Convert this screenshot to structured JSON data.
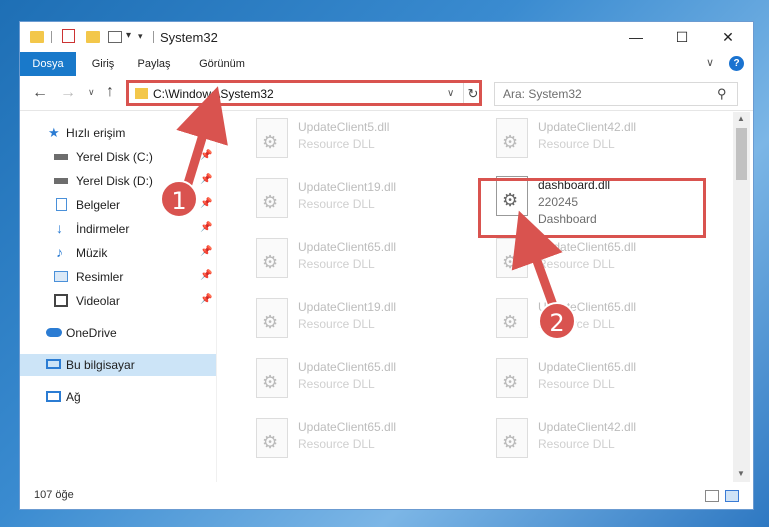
{
  "window": {
    "title": "System32",
    "qat_dropdown_glyph": "▾",
    "min_glyph": "—",
    "max_glyph": "☐",
    "close_glyph": "✕"
  },
  "ribbon": {
    "tabs": [
      "Dosya",
      "Giriş",
      "Paylaş",
      "Görünüm"
    ],
    "expand_glyph": "∨",
    "help_glyph": "?"
  },
  "nav": {
    "back_glyph": "←",
    "forward_glyph": "→",
    "recent_glyph": "∨",
    "up_glyph": "↑",
    "address": "C:\\Windows\\System32",
    "address_drop_glyph": "∨",
    "refresh_glyph": "↻",
    "search_placeholder": "Ara: System32",
    "search_glyph": "⚲"
  },
  "sidebar": {
    "pin_glyph": "📌",
    "items": [
      {
        "label": "Hızlı erişim",
        "icon": "star-icon",
        "color": "#2b7cd3",
        "pinned": false
      },
      {
        "label": "Yerel Disk (C:)",
        "icon": "drive-icon",
        "color": "#6d6d6d",
        "pinned": true
      },
      {
        "label": "Yerel Disk (D:)",
        "icon": "drive-icon",
        "color": "#6d6d6d",
        "pinned": true
      },
      {
        "label": "Belgeler",
        "icon": "documents-icon",
        "color": "#4a90d9",
        "pinned": true
      },
      {
        "label": "İndirmeler",
        "icon": "download-icon",
        "color": "#2b7cd3",
        "pinned": true
      },
      {
        "label": "Müzik",
        "icon": "music-icon",
        "color": "#2b7cd3",
        "pinned": true
      },
      {
        "label": "Resimler",
        "icon": "pictures-icon",
        "color": "#4a90d9",
        "pinned": true
      },
      {
        "label": "Videolar",
        "icon": "videos-icon",
        "color": "#444444",
        "pinned": true
      },
      {
        "label": "OneDrive",
        "icon": "cloud-icon",
        "color": "#2b7cd3",
        "pinned": false
      },
      {
        "label": "Bu bilgisayar",
        "icon": "computer-icon",
        "color": "#2b7cd3",
        "pinned": false,
        "selected": true
      },
      {
        "label": "Ağ",
        "icon": "network-icon",
        "color": "#2b7cd3",
        "pinned": false
      }
    ]
  },
  "files": {
    "gear_glyph": "⚙",
    "left": [
      {
        "name": "UpdateClient5.dll",
        "type": "Resource DLL"
      },
      {
        "name": "UpdateClient19.dll",
        "type": "Resource DLL"
      },
      {
        "name": "UpdateClient65.dll",
        "type": "Resource DLL"
      },
      {
        "name": "UpdateClient19.dll",
        "type": "Resource DLL"
      },
      {
        "name": "UpdateClient65.dll",
        "type": "Resource DLL"
      },
      {
        "name": "UpdateClient65.dll",
        "type": "Resource DLL"
      }
    ],
    "right": [
      {
        "name": "UpdateClient42.dll",
        "type": "Resource DLL"
      },
      {
        "name": "dashboard.dll",
        "type": "220245",
        "desc": "Dashboard",
        "active": true
      },
      {
        "name": "UpdateClient65.dll",
        "type": "Resource DLL"
      },
      {
        "name": "UpdateClient65.dll",
        "type": "Resource DLL"
      },
      {
        "name": "UpdateClient65.dll",
        "type": "Resource DLL"
      },
      {
        "name": "UpdateClient42.dll",
        "type": "Resource DLL"
      }
    ]
  },
  "scroll": {
    "up_glyph": "▲",
    "down_glyph": "▼"
  },
  "status": {
    "count": "107 öğe"
  },
  "annotations": {
    "step1": "1",
    "step2": "2",
    "color": "#d9534f"
  }
}
